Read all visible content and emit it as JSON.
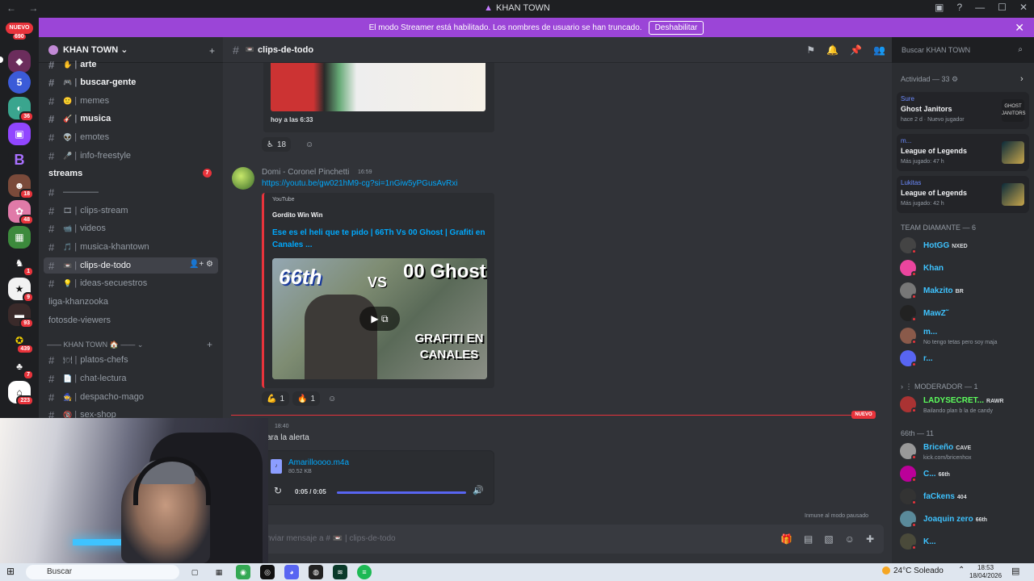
{
  "window": {
    "title": "KHAN TOWN",
    "nav_glyphs": "← →",
    "controls": [
      "▣",
      "?",
      "—",
      "☐",
      "✕"
    ]
  },
  "banner": {
    "text": "El modo Streamer está habilitado. Los nombres de usuario se han truncado.",
    "button": "Deshabilitar",
    "close": "✕"
  },
  "rail": {
    "new_badge": "NUEVO",
    "new_count": "690",
    "guild_badges": [
      "36",
      "18",
      "48",
      "1",
      "9",
      "93",
      "439",
      "7",
      "223"
    ]
  },
  "server": {
    "name": "KHAN TOWN ⌄",
    "add_icon": "+"
  },
  "channels": [
    {
      "name": "arte",
      "emoji": "✋",
      "unread": true
    },
    {
      "name": "buscar-gente",
      "emoji": "🎮",
      "unread": true
    },
    {
      "name": "memes",
      "emoji": "🙂",
      "unread": false
    },
    {
      "name": "musica",
      "emoji": "🎸",
      "unread": true
    },
    {
      "name": "emotes",
      "emoji": "👽",
      "unread": false
    },
    {
      "name": "info-freestyle",
      "emoji": "🎤",
      "unread": false
    },
    {
      "name": "streams",
      "unread": true,
      "badge": "7"
    },
    {
      "name": "————",
      "emoji": ""
    },
    {
      "name": "clips-stream",
      "emoji": "🎞",
      "unread": false
    },
    {
      "name": "videos",
      "emoji": "📹",
      "unread": false
    },
    {
      "name": "musica-khantown",
      "emoji": "🎵",
      "unread": false
    },
    {
      "name": "clips-de-todo",
      "emoji": "📼",
      "active": true
    },
    {
      "name": "ideas-secuestros",
      "emoji": "💡",
      "unread": false
    },
    {
      "name": "liga-khanzooka",
      "unread": false
    },
    {
      "name": "fotosde-viewers",
      "unread": false
    },
    {
      "name": "platos-chefs",
      "emoji": "🍽",
      "unread": false
    },
    {
      "name": "chat-lectura",
      "emoji": "📄",
      "unread": false
    },
    {
      "name": "despacho-mago",
      "emoji": "🧙",
      "unread": false
    },
    {
      "name": "sex-shop",
      "emoji": "🔞",
      "unread": false
    }
  ],
  "category": {
    "label": "—— KHAN TOWN 🏠 —— ⌄",
    "plus": "+"
  },
  "header": {
    "channel": "clips-de-todo",
    "search_placeholder": "Buscar KHAN TOWN"
  },
  "messages": {
    "clip_timestamp": "hoy a las 6:33",
    "reaction1": {
      "emoji": "♿",
      "count": "18"
    },
    "msg2": {
      "author": "Domi - Coronel Pinchetti",
      "time": "16:59",
      "link": "https://youtu.be/gw021hM9-cg?si=1nGiw5yPGusAvRxi",
      "embed_provider": "YouTube",
      "embed_author": "Gordito Win Win",
      "embed_title": "Ese es el heli que te pido | 66Th Vs 00 Ghost | Grafiti en Canales ...",
      "thumb_logo": "66th",
      "thumb_vs": "VS",
      "thumb_ghost": "00 Ghost",
      "thumb_graffiti": "GRAFITI EN CANALES"
    },
    "reactions2": [
      {
        "emoji": "💪",
        "count": "1"
      },
      {
        "emoji": "🔥",
        "count": "1"
      }
    ],
    "new_tag": "NUEVO",
    "msg3": {
      "time": "18:40",
      "text": "ara la alerta",
      "file_name": "Amarilloooo.m4a",
      "file_size": "80.52 KB",
      "audio_time": "0:05 / 0:05"
    },
    "paused_note": "Inmune al modo pausado",
    "composer_placeholder": "nviar mensaje a # 📼 | clips-de-todo"
  },
  "members": {
    "activity_header": "Actividad — 33",
    "activities": [
      {
        "user": "Sure",
        "game": "Ghost Janitors",
        "meta": "hace 2 d · Nuevo jugador",
        "art": "GHOST JANITORS"
      },
      {
        "user": "m...",
        "game": "League of Legends",
        "meta": "Más jugado: 47 h"
      },
      {
        "user": "Lukitas",
        "game": "League of Legends",
        "meta": "Más jugado: 42 h"
      }
    ],
    "section_diamante": "TEAM DIAMANTE — 6",
    "diamante": [
      {
        "name": "HotGG",
        "tag": "NXED",
        "color": "#3ec3ff"
      },
      {
        "name": "Khan",
        "color": "#3ec3ff"
      },
      {
        "name": "Makzito",
        "tag": "BR",
        "color": "#3ec3ff"
      },
      {
        "name": "MawZ˜",
        "color": "#3ec3ff"
      },
      {
        "name": "m...",
        "status": "No tengo tetas pero soy maja",
        "color": "#3ec3ff"
      },
      {
        "name": "r...",
        "color": "#3ec3ff"
      }
    ],
    "section_moderador": "› ⋮ MODERADOR — 1",
    "moderador": [
      {
        "name": "LADYSECRET...",
        "tag": "RAWR",
        "status": "Bailando plan b la de candy",
        "color": "#5dff5d"
      }
    ],
    "section_66th": "66th — 11",
    "m66th": [
      {
        "name": "Briceño",
        "tag": "CAVE",
        "status": "kick.com/bricenhox",
        "color": "#3ec3ff"
      },
      {
        "name": "C...",
        "tag": "66th",
        "color": "#3ec3ff"
      },
      {
        "name": "faCkens",
        "tag": "404",
        "color": "#3ec3ff"
      },
      {
        "name": "Joaquin zero",
        "tag": "66th",
        "color": "#3ec3ff"
      },
      {
        "name": "K...",
        "color": "#3ec3ff"
      }
    ]
  },
  "taskbar": {
    "search": "Buscar",
    "weather": "24°C  Soleado",
    "time": "18:53",
    "date": "18/04/2026"
  }
}
